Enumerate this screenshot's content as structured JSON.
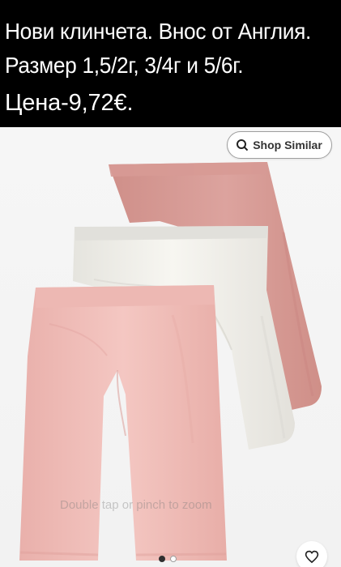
{
  "caption": {
    "line_1": "Нови клинчета. Внос от Англия.",
    "line_2": "Размер 1,5/2г, 3/4г и 5/6г.",
    "line_3": "Цена-9,72€."
  },
  "product_image": {
    "zoom_hint": "Double tap or pinch to zoom"
  },
  "shop_similar": {
    "label": "Shop Similar",
    "icon": "search-icon"
  },
  "gallery": {
    "current_page": 1,
    "total_pages": 2
  },
  "favorite": {
    "icon": "heart-icon"
  },
  "colors": {
    "caption_background": "#000000",
    "caption_text": "#ffffff",
    "dusty_pink_shorts": "#d9a39c",
    "ivory_shorts": "#f3f2ec",
    "light_pink_shorts": "#f0c0bb"
  }
}
